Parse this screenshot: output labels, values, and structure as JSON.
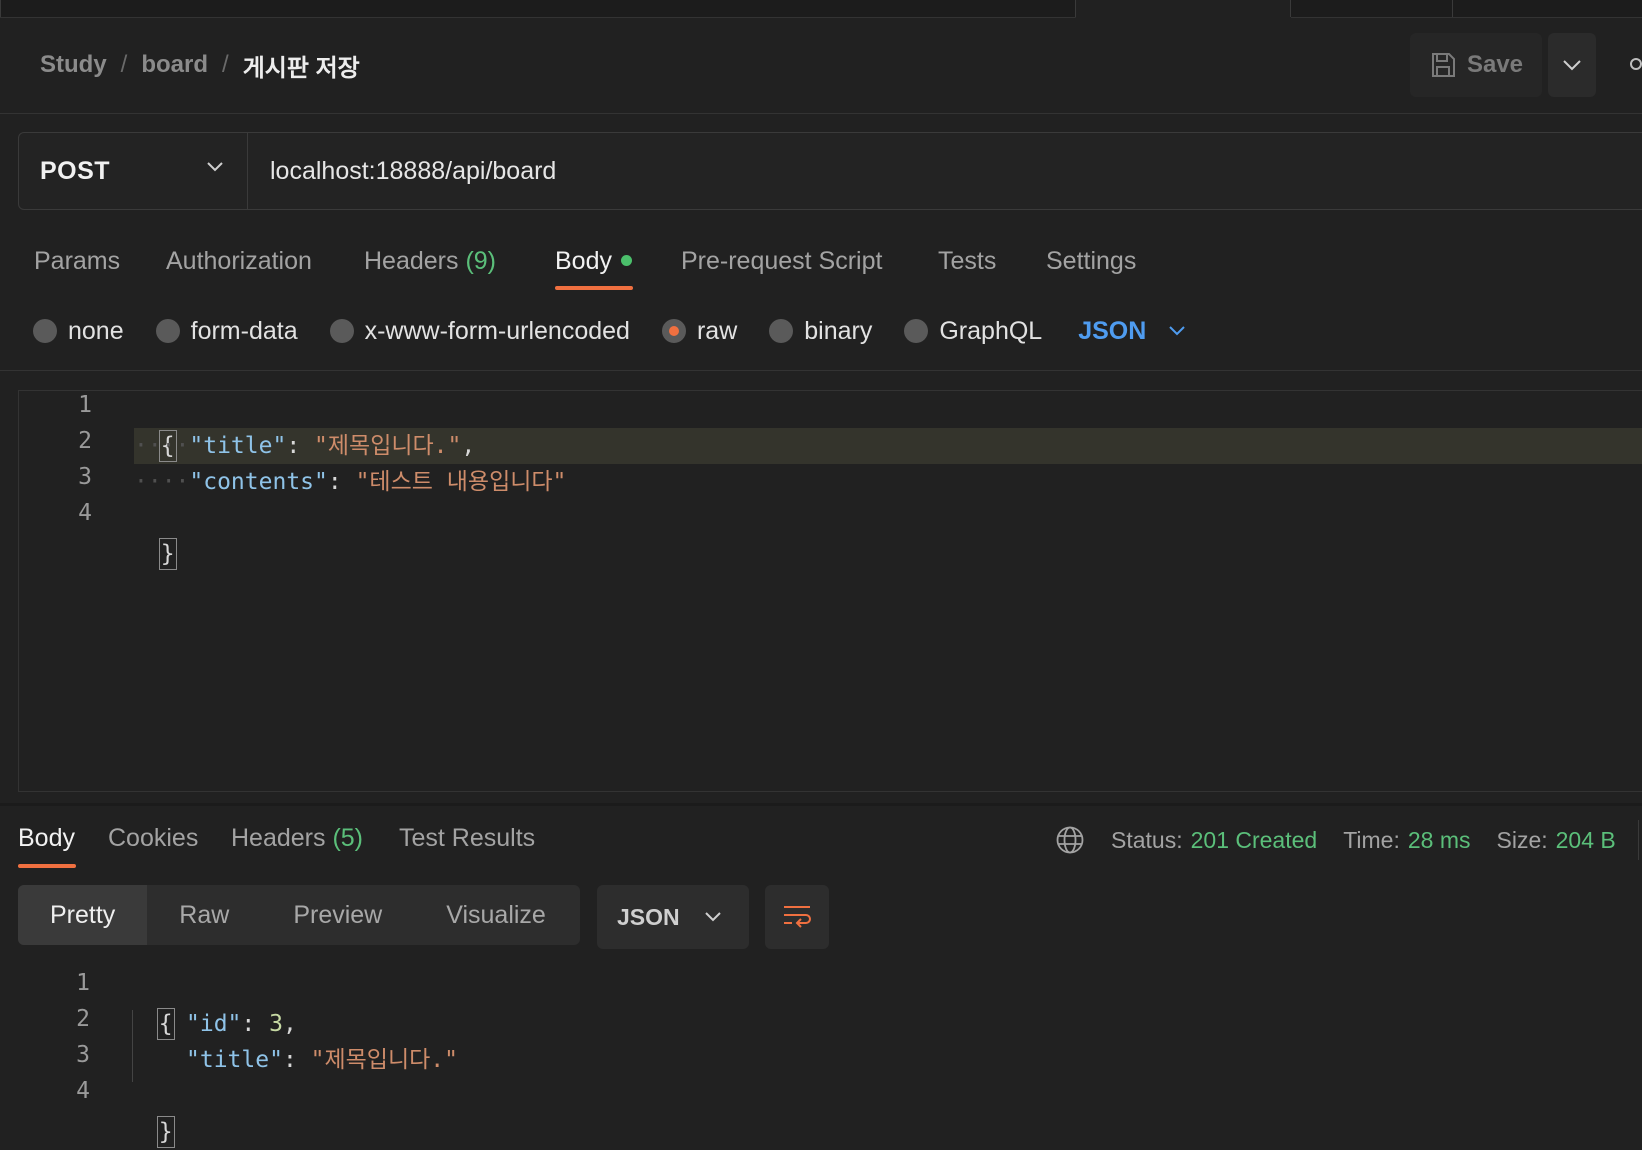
{
  "breadcrumb": {
    "items": [
      "Study",
      "board"
    ],
    "separator": "/",
    "current": "게시판 저장"
  },
  "toolbar": {
    "save_label": "Save",
    "save_icon": "floppy-disk-icon",
    "save_menu_icon": "chevron-down-icon",
    "more_icon": "more-options-icon"
  },
  "request": {
    "method": "POST",
    "url": "localhost:18888/api/board"
  },
  "request_tabs": {
    "params": "Params",
    "authorization": "Authorization",
    "headers_label": "Headers",
    "headers_count": "(9)",
    "body": "Body",
    "prerequest": "Pre-request Script",
    "tests": "Tests",
    "settings": "Settings",
    "active": "Body"
  },
  "body_types": {
    "none": "none",
    "form_data": "form-data",
    "urlencoded": "x-www-form-urlencoded",
    "raw": "raw",
    "binary": "binary",
    "graphql": "GraphQL",
    "selected": "raw",
    "language": "JSON"
  },
  "editor": {
    "line_numbers": [
      "1",
      "2",
      "3",
      "4"
    ],
    "lines": {
      "open": "{",
      "k1": "\"title\"",
      "v1": "\"제목입니다.\"",
      "k2": "\"contents\"",
      "v2": "\"테스트 내용입니다\"",
      "close": "}"
    }
  },
  "response_tabs": {
    "body": "Body",
    "cookies": "Cookies",
    "headers_label": "Headers",
    "headers_count": "(5)",
    "test_results": "Test Results",
    "active": "Body"
  },
  "response_meta": {
    "status_label": "Status:",
    "status_value": "201 Created",
    "time_label": "Time:",
    "time_value": "28 ms",
    "size_label": "Size:",
    "size_value": "204 B",
    "status_color": "#5bbf7a"
  },
  "response_view": {
    "modes": [
      "Pretty",
      "Raw",
      "Preview",
      "Visualize"
    ],
    "active": "Pretty",
    "format": "JSON",
    "wrap_icon": "wrap-lines-icon"
  },
  "response_body": {
    "line_numbers": [
      "1",
      "2",
      "3",
      "4"
    ],
    "lines": {
      "open": "{",
      "k1": "\"id\"",
      "v1": "3",
      "k2": "\"title\"",
      "v2": "\"제목입니다.\"",
      "close": "}"
    }
  },
  "colors": {
    "accent_orange": "#f07040",
    "success_green": "#5bbf7a",
    "link_blue": "#4f9cf0",
    "background": "#212121"
  }
}
